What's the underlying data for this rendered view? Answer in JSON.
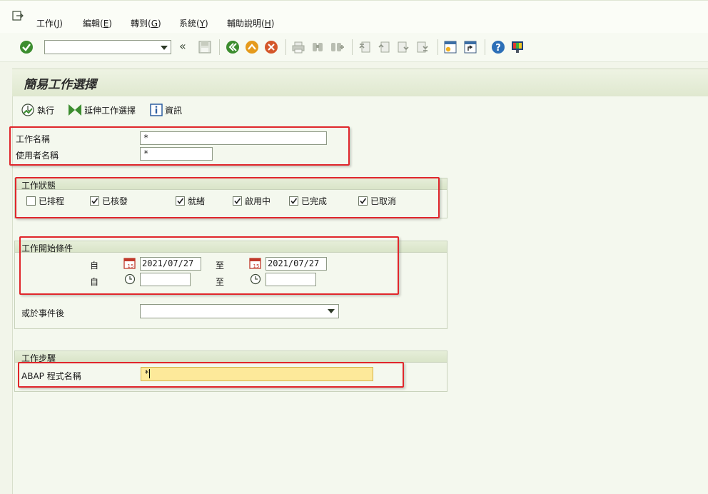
{
  "menu": {
    "items": [
      {
        "text": "工作(",
        "key": "J",
        "tail": ")"
      },
      {
        "text": "編輯(",
        "key": "E",
        "tail": ")"
      },
      {
        "text": "轉到(",
        "key": "G",
        "tail": ")"
      },
      {
        "text": "系統(",
        "key": "Y",
        "tail": ")"
      },
      {
        "text": "輔助說明(",
        "key": "H",
        "tail": ")"
      }
    ]
  },
  "toolbar": {
    "command_value": "",
    "back_glyph": "«"
  },
  "page": {
    "title": "簡易工作選擇"
  },
  "app_toolbar": {
    "execute": "執行",
    "extended": "延伸工作選擇",
    "info": "資訊"
  },
  "job": {
    "name_label": "工作名稱",
    "name_value": "*",
    "user_label": "使用者名稱",
    "user_value": "*"
  },
  "status": {
    "title": "工作狀態",
    "items": [
      {
        "label": "已排程",
        "checked": false
      },
      {
        "label": "已核發",
        "checked": true
      },
      {
        "label": "就緒",
        "checked": true
      },
      {
        "label": "啟用中",
        "checked": true
      },
      {
        "label": "已完成",
        "checked": true
      },
      {
        "label": "已取消",
        "checked": true
      }
    ]
  },
  "start": {
    "title": "工作開始條件",
    "from_label": "自",
    "to_label": "至",
    "from_date": "2021/07/27",
    "to_date": "2021/07/27",
    "from_time": "",
    "to_time": "",
    "event_label": "或於事件後",
    "event_value": ""
  },
  "steps": {
    "title": "工作步驟",
    "abap_label": "ABAP 程式名稱",
    "abap_value": "*"
  },
  "colors": {
    "accent_green": "#3c8d2f",
    "highlight_field": "#fde99a",
    "annotation_red": "#e0262b"
  }
}
